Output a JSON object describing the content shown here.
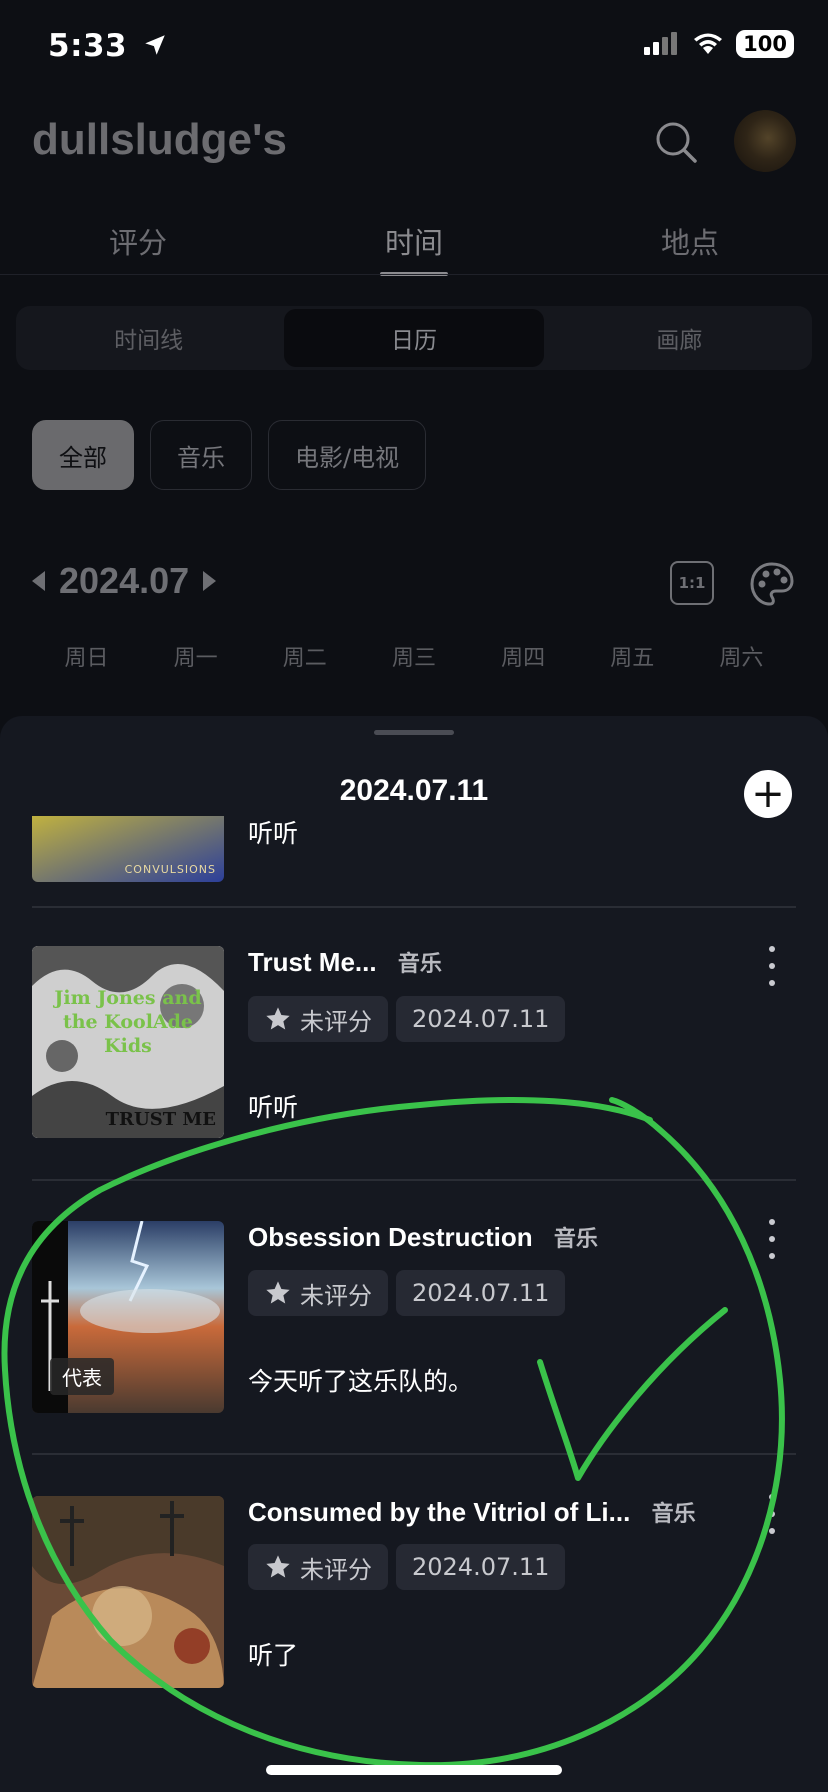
{
  "status": {
    "time": "5:33",
    "battery": "100"
  },
  "header": {
    "title": "dullsludge's"
  },
  "tabs": [
    {
      "label": "评分"
    },
    {
      "label": "时间"
    },
    {
      "label": "地点"
    }
  ],
  "segments": [
    {
      "label": "时间线"
    },
    {
      "label": "日历"
    },
    {
      "label": "画廊"
    }
  ],
  "filters": [
    {
      "label": "全部"
    },
    {
      "label": "音乐"
    },
    {
      "label": "电影/电视"
    }
  ],
  "calendar": {
    "month": "2024.07",
    "ratio_label": "1:1",
    "weekdays": [
      "周日",
      "周一",
      "周二",
      "周三",
      "周四",
      "周五",
      "周六"
    ]
  },
  "sheet": {
    "date": "2024.07.11",
    "add_label": "+",
    "partial_note": "听听",
    "partial_cover_text": "CONVULSIONS",
    "items": [
      {
        "title": "Trust Me...",
        "type": "音乐",
        "rating": "未评分",
        "date": "2024.07.11",
        "note": "听听",
        "cover_text": "Jim Jones and the KoolAde Kids",
        "cover_sub": "TRUST ME"
      },
      {
        "title": "Obsession Destruction",
        "type": "音乐",
        "rating": "未评分",
        "date": "2024.07.11",
        "note": "今天听了这乐队的。",
        "tag": "代表"
      },
      {
        "title": "Consumed by the Vitriol of Li...",
        "type": "音乐",
        "rating": "未评分",
        "date": "2024.07.11",
        "note": "听了"
      }
    ]
  },
  "colors": {
    "accent_scribble": "#3ac24a",
    "sheet_bg": "#151820",
    "badge_bg": "#262933"
  }
}
